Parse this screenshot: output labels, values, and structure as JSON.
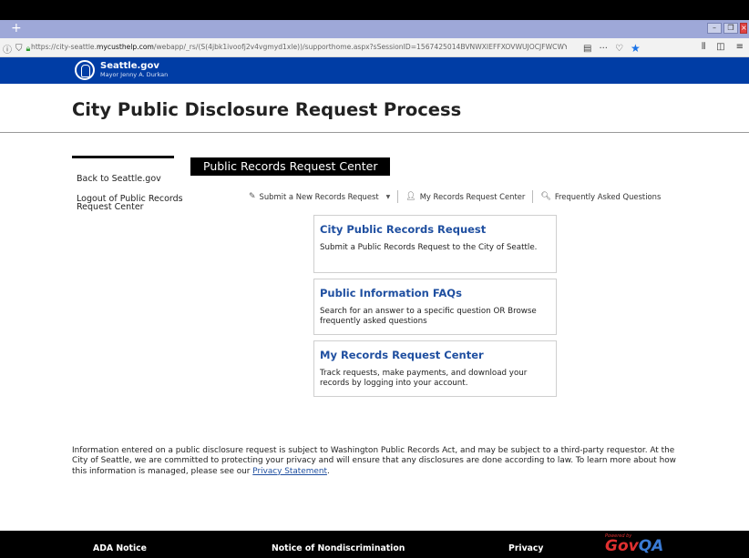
{
  "browser": {
    "url_prefix": "https://city-seattle.",
    "url_domain": "mycusthelp.com",
    "url_path": "/webapp/_rs/(S(4jbk1ivoofj2v4vgmyd1xle))/supporthome.aspx?sSessionID=1567425014BVNWXIEFFXOVWUJOCJFWCWYRS"
  },
  "site": {
    "name": "Seattle.gov",
    "mayor": "Mayor Jenny A. Durkan"
  },
  "page": {
    "title": "City Public Disclosure Request Process"
  },
  "sidebar": {
    "links": [
      {
        "label": "Back to Seattle.gov"
      },
      {
        "label": "Logout of Public Records Request Center"
      }
    ]
  },
  "center": {
    "title": "Public Records Request Center"
  },
  "subnav": {
    "submit_label": "Submit a New Records Request",
    "my_center_label": "My Records Request Center",
    "faq_label": "Frequently Asked Questions"
  },
  "cards": [
    {
      "title": "City Public Records Request",
      "desc": "Submit a Public Records Request to the City of Seattle."
    },
    {
      "title": "Public Information FAQs",
      "desc": "Search for an answer to a specific question OR Browse frequently asked questions"
    },
    {
      "title": "My Records Request Center",
      "desc": "Track requests, make payments, and download your records by logging into your account."
    }
  ],
  "disclaimer": {
    "text": "Information entered on a public disclosure request is subject to Washington Public Records Act, and may be subject to a third-party requestor. At the City of Seattle, we are committed to protecting your privacy and will ensure that any disclosures are done according to law. To learn more about how this information is managed, please see our ",
    "link": "Privacy Statement",
    "end": "."
  },
  "footer": {
    "links": [
      "ADA Notice",
      "Notice of Nondiscrimination",
      "Privacy"
    ],
    "powered_by": "Powered by",
    "logo_gov": "Gov",
    "logo_qa": "QA"
  }
}
